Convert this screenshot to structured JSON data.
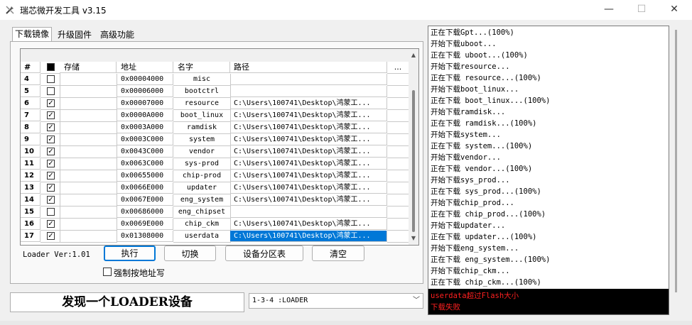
{
  "window": {
    "title": "瑞芯微开发工具 v3.15",
    "minimize": "—",
    "maximize": "☐",
    "close": "✕"
  },
  "tabs": [
    {
      "label": "下载镜像",
      "active": true
    },
    {
      "label": "升级固件",
      "active": false
    },
    {
      "label": "高级功能",
      "active": false
    }
  ],
  "table": {
    "columns": [
      "#",
      "",
      "存储",
      "地址",
      "名字",
      "路径",
      "..."
    ],
    "rows": [
      {
        "num": "4",
        "checked": false,
        "storage": "",
        "address": "0x00004000",
        "name": "misc",
        "path": ""
      },
      {
        "num": "5",
        "checked": false,
        "storage": "",
        "address": "0x00006000",
        "name": "bootctrl",
        "path": ""
      },
      {
        "num": "6",
        "checked": true,
        "storage": "",
        "address": "0x00007000",
        "name": "resource",
        "path": "C:\\Users\\100741\\Desktop\\鸿蒙工..."
      },
      {
        "num": "7",
        "checked": true,
        "storage": "",
        "address": "0x0000A000",
        "name": "boot_linux",
        "path": "C:\\Users\\100741\\Desktop\\鸿蒙工..."
      },
      {
        "num": "8",
        "checked": true,
        "storage": "",
        "address": "0x0003A000",
        "name": "ramdisk",
        "path": "C:\\Users\\100741\\Desktop\\鸿蒙工..."
      },
      {
        "num": "9",
        "checked": true,
        "storage": "",
        "address": "0x0003C000",
        "name": "system",
        "path": "C:\\Users\\100741\\Desktop\\鸿蒙工..."
      },
      {
        "num": "10",
        "checked": true,
        "storage": "",
        "address": "0x0043C000",
        "name": "vendor",
        "path": "C:\\Users\\100741\\Desktop\\鸿蒙工..."
      },
      {
        "num": "11",
        "checked": true,
        "storage": "",
        "address": "0x0063C000",
        "name": "sys-prod",
        "path": "C:\\Users\\100741\\Desktop\\鸿蒙工..."
      },
      {
        "num": "12",
        "checked": true,
        "storage": "",
        "address": "0x00655000",
        "name": "chip-prod",
        "path": "C:\\Users\\100741\\Desktop\\鸿蒙工..."
      },
      {
        "num": "13",
        "checked": true,
        "storage": "",
        "address": "0x0066E000",
        "name": "updater",
        "path": "C:\\Users\\100741\\Desktop\\鸿蒙工..."
      },
      {
        "num": "14",
        "checked": true,
        "storage": "",
        "address": "0x0067E000",
        "name": "eng_system",
        "path": "C:\\Users\\100741\\Desktop\\鸿蒙工..."
      },
      {
        "num": "15",
        "checked": false,
        "storage": "",
        "address": "0x00686000",
        "name": "eng_chipset",
        "path": ""
      },
      {
        "num": "16",
        "checked": true,
        "storage": "",
        "address": "0x0069E000",
        "name": "chip_ckm",
        "path": "C:\\Users\\100741\\Desktop\\鸿蒙工..."
      },
      {
        "num": "17",
        "checked": true,
        "storage": "",
        "address": "0x01308000",
        "name": "userdata",
        "path": "C:\\Users\\100741\\Desktop\\鸿蒙工...",
        "selected": true
      }
    ]
  },
  "controls": {
    "loader_version": "Loader Ver:1.01",
    "execute": "执行",
    "switch": "切换",
    "partition_table": "设备分区表",
    "clear": "清空",
    "force_address": "强制按地址写"
  },
  "status": {
    "message": "发现一个LOADER设备",
    "device": "1-3-4 :LOADER"
  },
  "log": {
    "lines": [
      "正在下载Gpt...(100%)",
      "开始下载uboot...",
      "正在下载 uboot...(100%)",
      "开始下载resource...",
      "正在下载 resource...(100%)",
      "开始下载boot_linux...",
      "正在下载 boot_linux...(100%)",
      "开始下载ramdisk...",
      "正在下载 ramdisk...(100%)",
      "开始下载system...",
      "正在下载 system...(100%)",
      "开始下载vendor...",
      "正在下载 vendor...(100%)",
      "开始下载sys_prod...",
      "正在下载 sys_prod...(100%)",
      "开始下载chip_prod...",
      "正在下载 chip_prod...(100%)",
      "开始下载updater...",
      "正在下载 updater...(100%)",
      "开始下载eng_system...",
      "正在下载 eng_system...(100%)",
      "开始下载chip_ckm...",
      "正在下载 chip_ckm...(100%)"
    ],
    "errors": [
      "userdata超过Flash大小",
      "下载失败"
    ],
    "error_color": "#ff2020"
  },
  "colors": {
    "selection": "#0078d7",
    "primary_border": "#0078d7"
  }
}
